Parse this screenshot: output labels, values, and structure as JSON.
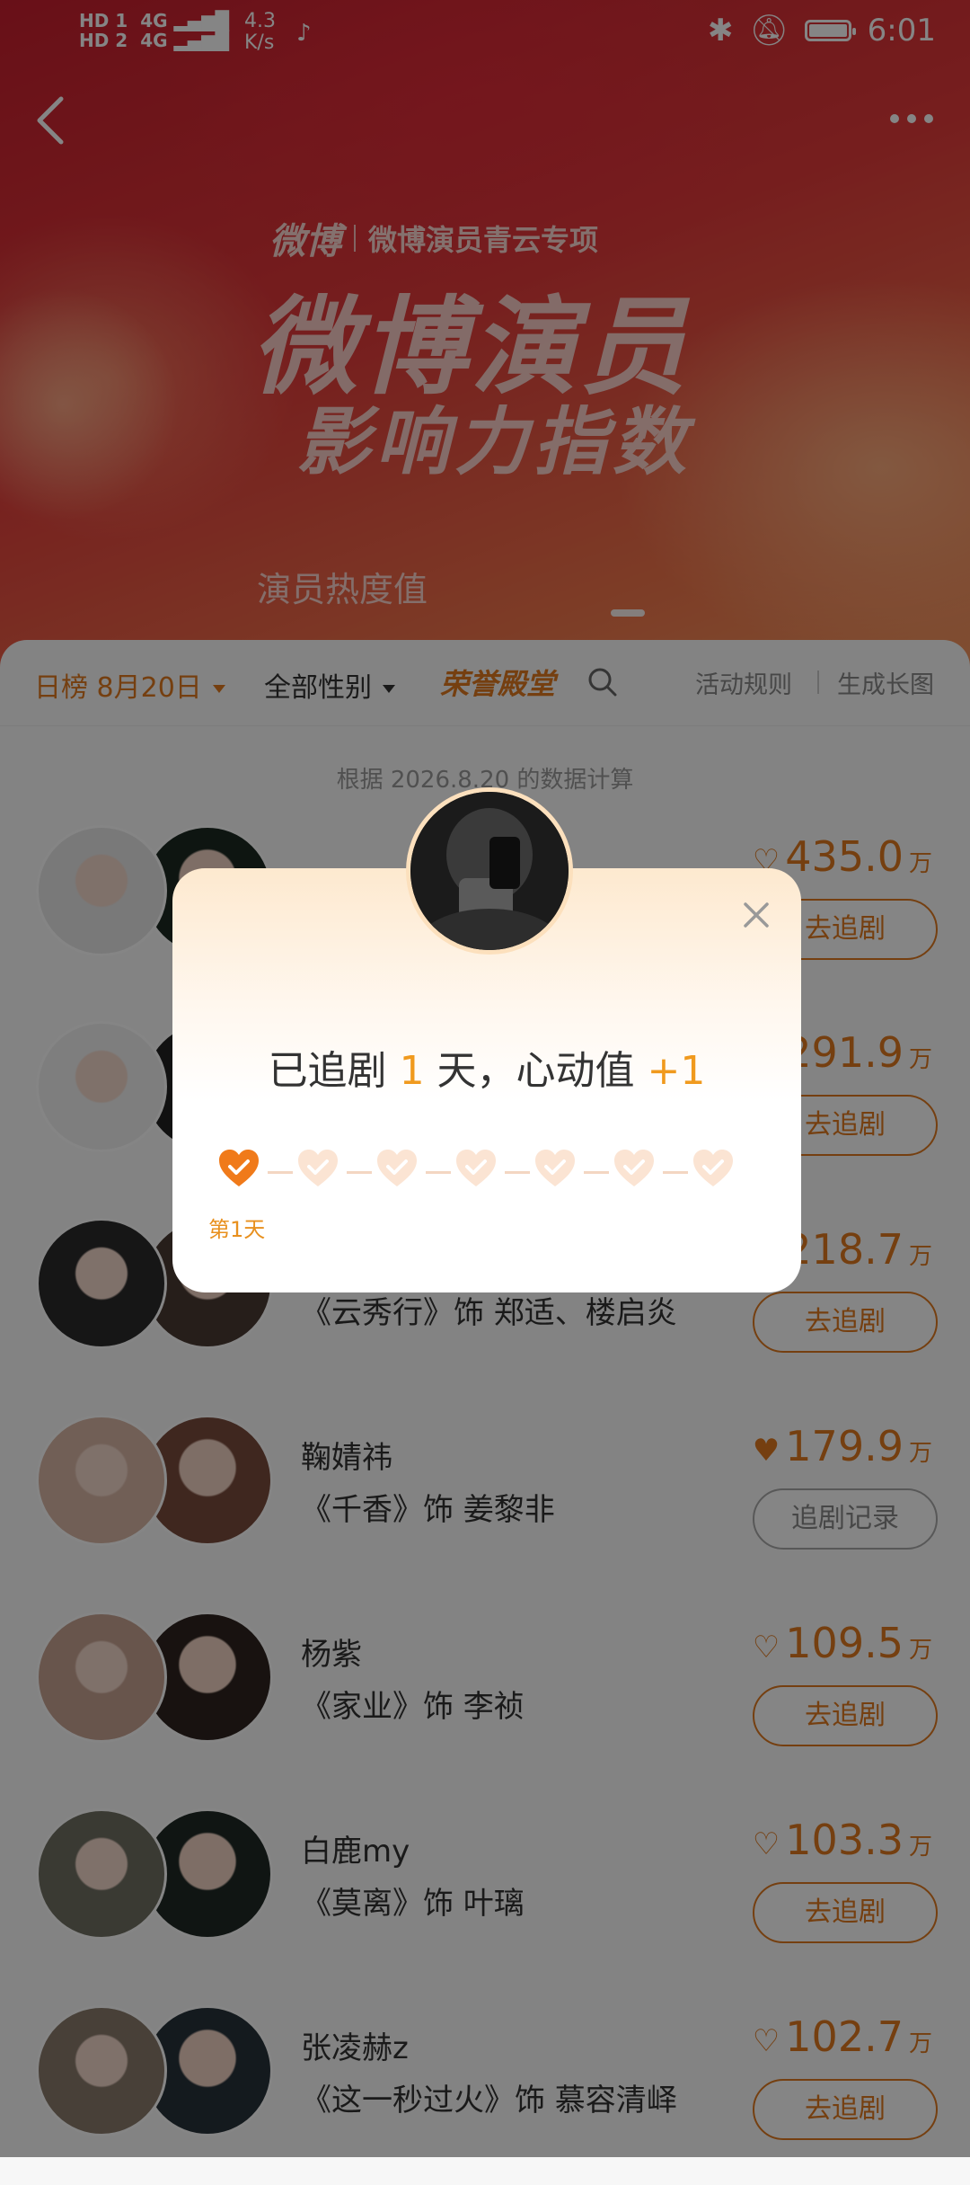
{
  "status_bar": {
    "network_1": "HD 1",
    "network_2": "HD 2",
    "sig_1": "4G",
    "sig_2": "4G",
    "speed": "4.3\nK/s",
    "time": "6:01"
  },
  "hero": {
    "brand_logo": "微博",
    "brand_program": "微博演员青云专项",
    "title": "微博演员",
    "subtitle": "影响力指数",
    "caption": "演员热度值"
  },
  "filter_bar": {
    "date": "日榜 8月20日",
    "gender": "全部性别",
    "honor": "荣誉殿堂",
    "rules": "活动规则",
    "long_image": "生成长图"
  },
  "calc_note": "根据 2026.8.20 的数据计算",
  "rows": [
    {
      "name": "",
      "role": "",
      "score": "435.0",
      "unit": "万",
      "button": "去追剧",
      "liked": false
    },
    {
      "name": "",
      "role": "",
      "score": "291.9",
      "unit": "万",
      "button": "去追剧",
      "liked": false
    },
    {
      "name": "",
      "role": "《云秀行》饰 郑适、楼启炎",
      "score": "218.7",
      "unit": "万",
      "button": "去追剧",
      "liked": false
    },
    {
      "name": "鞠婧祎",
      "role": "《千香》饰 姜黎非",
      "score": "179.9",
      "unit": "万",
      "button": "追剧记录",
      "liked": true
    },
    {
      "name": "杨紫",
      "role": "《家业》饰 李祯",
      "score": "109.5",
      "unit": "万",
      "button": "去追剧",
      "liked": false
    },
    {
      "name": "白鹿my",
      "role": "《莫离》饰 叶璃",
      "score": "103.3",
      "unit": "万",
      "button": "去追剧",
      "liked": false
    },
    {
      "name": "张凌赫z",
      "role": "《这一秒过火》饰 慕容清峄",
      "score": "102.7",
      "unit": "万",
      "button": "去追剧",
      "liked": false
    }
  ],
  "modal": {
    "msg_prefix": "已追剧 ",
    "days": "1",
    "msg_mid": " 天，心动值 ",
    "bonus": "+1",
    "day_label": "第1天",
    "total_steps": 7,
    "completed_steps": 1
  },
  "colors": {
    "accent": "#e07a1f",
    "highlight": "#f09a1e",
    "hero_red": "#d62a35"
  }
}
